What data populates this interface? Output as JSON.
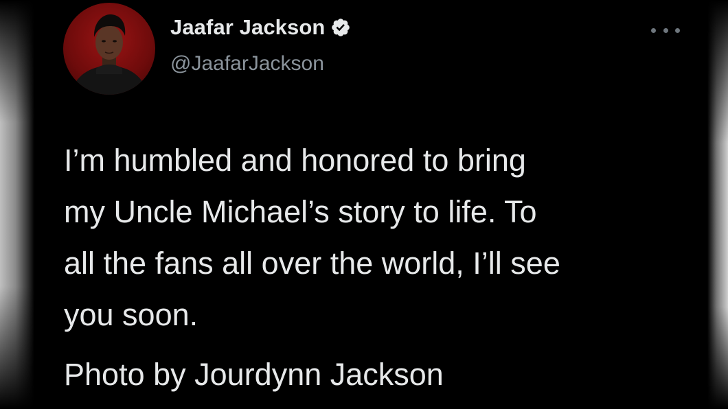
{
  "tweet": {
    "author": {
      "name": "Jaafar Jackson",
      "handle": "@JaafarJackson",
      "verified": true,
      "avatar_icon": "profile-photo"
    },
    "more_icon": "more-horizontal-icon",
    "text": "I’m humbled and honored to bring\nmy Uncle Michael’s story to life. To\nall the fans all over the world, I’ll see\nyou soon.",
    "photo_credit": "Photo by Jourdynn Jackson"
  },
  "colors": {
    "background": "#000000",
    "text_primary": "#e7e9ea",
    "text_secondary": "#8b949c",
    "avatar_background": "#8b1010"
  }
}
